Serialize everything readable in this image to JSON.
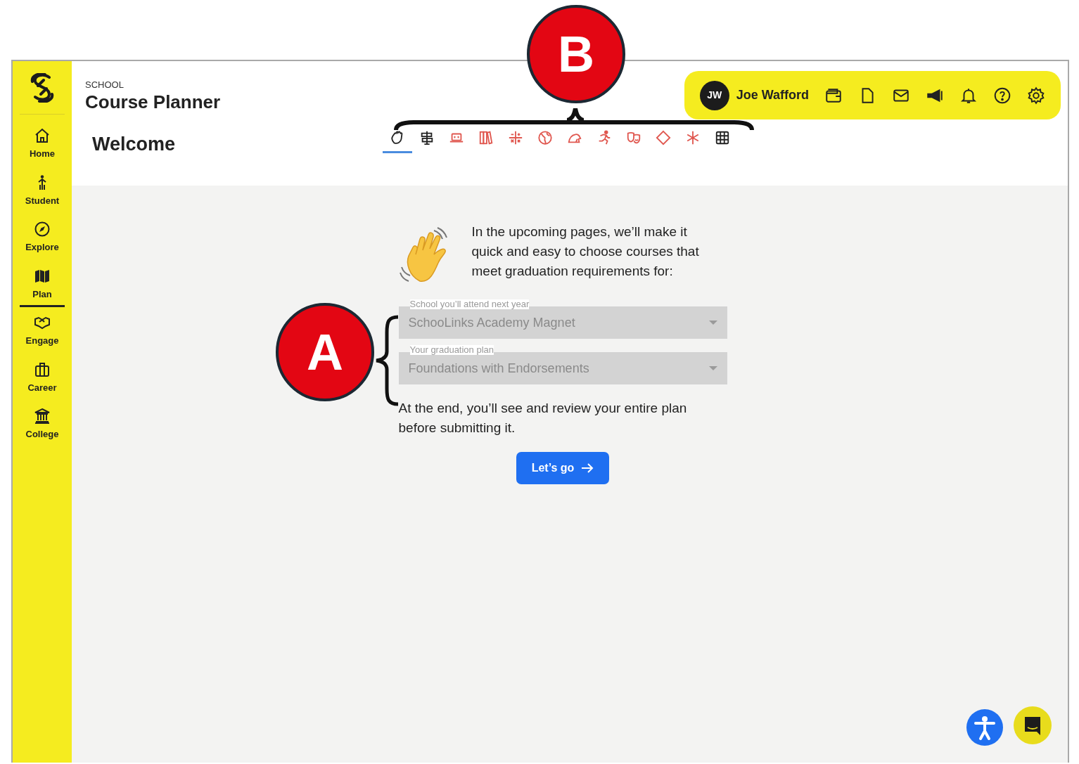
{
  "sidebar": {
    "items": [
      {
        "label": "Home",
        "selected": false
      },
      {
        "label": "Student",
        "selected": false
      },
      {
        "label": "Explore",
        "selected": false
      },
      {
        "label": "Plan",
        "selected": true
      },
      {
        "label": "Engage",
        "selected": false
      },
      {
        "label": "Career",
        "selected": false
      },
      {
        "label": "College",
        "selected": false
      }
    ]
  },
  "header": {
    "eyebrow": "SCHOOL",
    "title": "Course Planner",
    "page_title": "Welcome"
  },
  "user": {
    "initials": "JW",
    "name": "Joe Wafford"
  },
  "tabs": [
    {
      "selected": true,
      "color": "#222222"
    },
    {
      "selected": false,
      "color": "#222222"
    },
    {
      "selected": false,
      "color": "#e0574f"
    },
    {
      "selected": false,
      "color": "#e0574f"
    },
    {
      "selected": false,
      "color": "#e0574f"
    },
    {
      "selected": false,
      "color": "#e0574f"
    },
    {
      "selected": false,
      "color": "#e0574f"
    },
    {
      "selected": false,
      "color": "#e0574f"
    },
    {
      "selected": false,
      "color": "#e0574f"
    },
    {
      "selected": false,
      "color": "#e0574f"
    },
    {
      "selected": false,
      "color": "#e0574f"
    },
    {
      "selected": false,
      "color": "#222222"
    }
  ],
  "welcome": {
    "intro": "In the upcoming pages, we’ll make it quick and easy to choose courses that meet graduation requirements for:",
    "fields": [
      {
        "label": "School you’ll attend next year",
        "value": "SchooLinks Academy Magnet",
        "disabled": true
      },
      {
        "label": "Your graduation plan",
        "value": "Foundations with Endorsements",
        "disabled": true
      }
    ],
    "outro": "At the end, you’ll see and review your entire plan before submitting it.",
    "button": "Let’s go"
  },
  "callouts": [
    {
      "label": "A"
    },
    {
      "label": "B"
    }
  ]
}
